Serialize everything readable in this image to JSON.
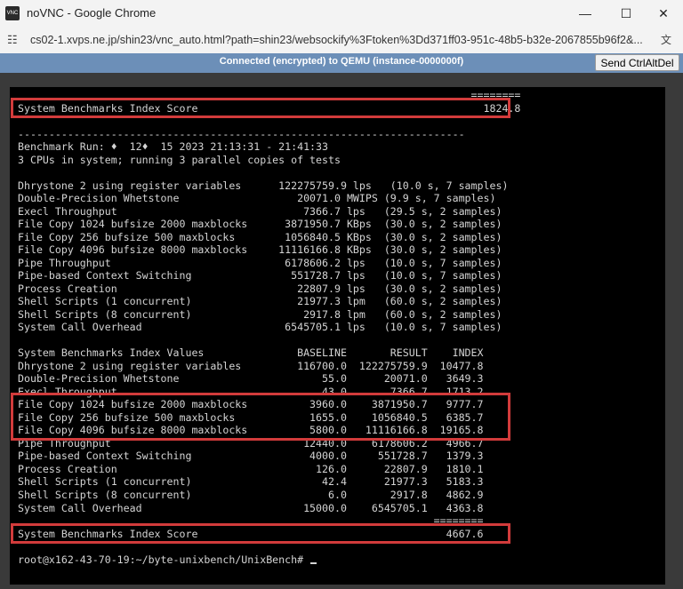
{
  "window": {
    "app_icon": "VNC",
    "title": "noVNC - Google Chrome",
    "minimize": "—",
    "maximize": "☐",
    "close": "✕"
  },
  "address_bar": {
    "url": "cs02-1.xvps.ne.jp/shin23/vnc_auto.html?path=shin23/websockify%3Ftoken%3Dd371ff03-951c-48b5-b32e-2067855b96f2&..."
  },
  "vnc": {
    "status": "Connected (encrypted) to QEMU (instance-0000000f)",
    "send_cad_label": "Send CtrlAltDel"
  },
  "terminal": {
    "lines": [
      "                                                                         ========",
      "System Benchmarks Index Score                                              1824.8",
      "",
      "------------------------------------------------------------------------",
      "Benchmark Run: ♦  12♦  15 2023 21:13:31 - 21:41:33",
      "3 CPUs in system; running 3 parallel copies of tests",
      "",
      "Dhrystone 2 using register variables      122275759.9 lps   (10.0 s, 7 samples)",
      "Double-Precision Whetstone                   20071.0 MWIPS (9.9 s, 7 samples)",
      "Execl Throughput                              7366.7 lps   (29.5 s, 2 samples)",
      "File Copy 1024 bufsize 2000 maxblocks      3871950.7 KBps  (30.0 s, 2 samples)",
      "File Copy 256 bufsize 500 maxblocks        1056840.5 KBps  (30.0 s, 2 samples)",
      "File Copy 4096 bufsize 8000 maxblocks     11116166.8 KBps  (30.0 s, 2 samples)",
      "Pipe Throughput                            6178606.2 lps   (10.0 s, 7 samples)",
      "Pipe-based Context Switching                551728.7 lps   (10.0 s, 7 samples)",
      "Process Creation                             22807.9 lps   (30.0 s, 2 samples)",
      "Shell Scripts (1 concurrent)                 21977.3 lpm   (60.0 s, 2 samples)",
      "Shell Scripts (8 concurrent)                  2917.8 lpm   (60.0 s, 2 samples)",
      "System Call Overhead                       6545705.1 lps   (10.0 s, 7 samples)",
      "",
      "System Benchmarks Index Values               BASELINE       RESULT    INDEX",
      "Dhrystone 2 using register variables         116700.0  122275759.9  10477.8",
      "Double-Precision Whetstone                       55.0      20071.0   3649.3",
      "Execl Throughput                                 43.0       7366.7   1713.2",
      "File Copy 1024 bufsize 2000 maxblocks          3960.0    3871950.7   9777.7",
      "File Copy 256 bufsize 500 maxblocks            1655.0    1056840.5   6385.7",
      "File Copy 4096 bufsize 8000 maxblocks          5800.0   11116166.8  19165.8",
      "Pipe Throughput                               12440.0    6178606.2   4966.7",
      "Pipe-based Context Switching                   4000.0     551728.7   1379.3",
      "Process Creation                                126.0      22807.9   1810.1",
      "Shell Scripts (1 concurrent)                     42.4      21977.3   5183.3",
      "Shell Scripts (8 concurrent)                      6.0       2917.8   4862.9",
      "System Call Overhead                          15000.0    6545705.1   4363.8",
      "                                                                   ========",
      "System Benchmarks Index Score                                        4667.6",
      "",
      "root@x162-43-70-19:~/byte-unixbench/UnixBench# "
    ]
  }
}
